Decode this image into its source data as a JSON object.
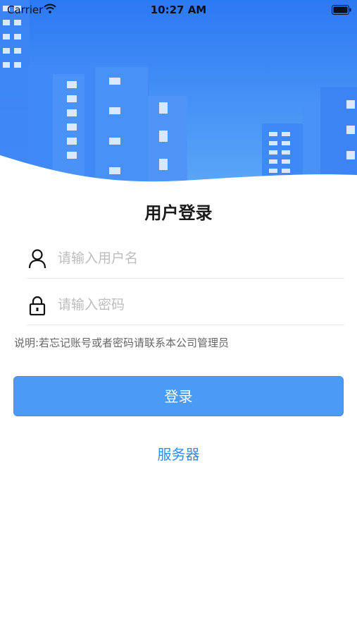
{
  "status_bar": {
    "carrier": "Carrier",
    "time": "10:27 AM"
  },
  "login": {
    "title": "用户登录",
    "username_placeholder": "请输入用户名",
    "password_placeholder": "请输入密码",
    "note": "说明:若忘记账号或者密码请联系本公司管理员",
    "login_button": "登录",
    "server_link": "服务器"
  },
  "colors": {
    "banner_blue": "#2f7ef5",
    "button_blue": "#4a9bf5",
    "link_blue": "#2f8ee8"
  },
  "icons": {
    "username": "user-icon",
    "password": "lock-icon"
  }
}
